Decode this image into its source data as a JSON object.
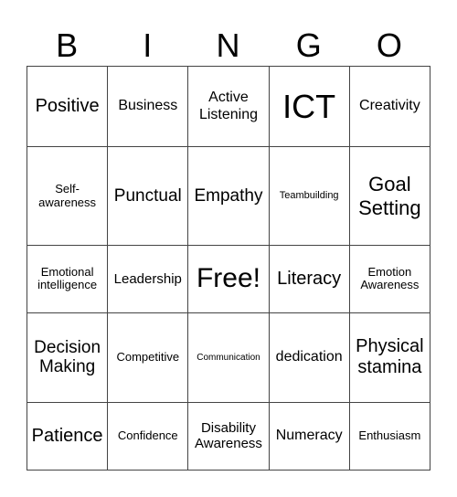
{
  "header": [
    "B",
    "I",
    "N",
    "G",
    "O"
  ],
  "grid": [
    [
      "Positive",
      "Business",
      "Active Listening",
      "ICT",
      "Creativity"
    ],
    [
      "Self-awareness",
      "Punctual",
      "Empathy",
      "Teambuilding",
      "Goal Setting"
    ],
    [
      "Emotional intelligence",
      "Leadership",
      "Free!",
      "Literacy",
      "Emotion Awareness"
    ],
    [
      "Decision Making",
      "Competitive",
      "Communication",
      "dedication",
      "Physical stamina"
    ],
    [
      "Patience",
      "Confidence",
      "Disability Awareness",
      "Numeracy",
      "Enthusiasm"
    ]
  ]
}
